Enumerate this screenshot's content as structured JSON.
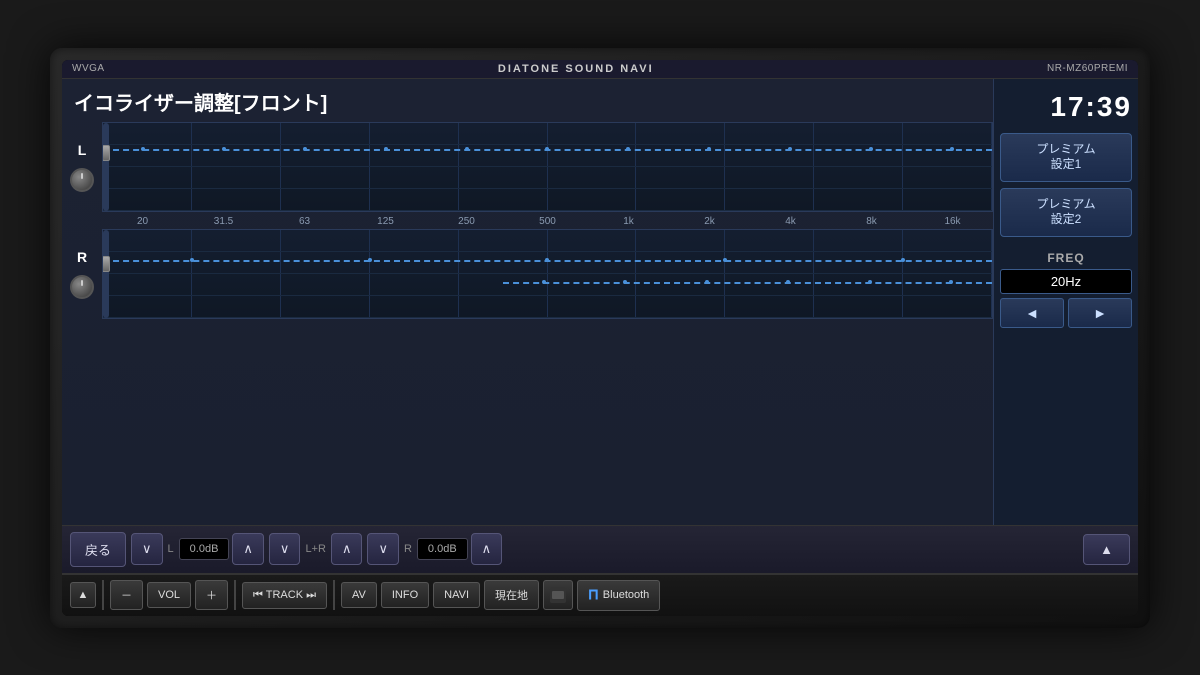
{
  "device": {
    "brand": "DIATONE SOUND NAVI",
    "model": "NR-MZ60PREMI",
    "screen_type": "WVGA"
  },
  "header": {
    "screen_type": "WVGA",
    "brand": "DIATONE SOUND NAVI",
    "model": "NR-MZ60PREMI",
    "time": "17:39"
  },
  "eq_screen": {
    "title": "イコライザー調整[フロント]",
    "channels": [
      "L",
      "R"
    ],
    "freq_labels": [
      "20",
      "31.5",
      "63",
      "125",
      "250",
      "500",
      "1k",
      "2k",
      "4k",
      "8k",
      "16k"
    ],
    "presets": [
      {
        "label": "プレミアム\n設定1"
      },
      {
        "label": "プレミアム\n設定2"
      }
    ],
    "freq_section": {
      "label": "FREQ",
      "value": "20Hz",
      "prev_label": "◄",
      "next_label": "►"
    }
  },
  "control_bar": {
    "back_label": "戻る",
    "down_label": "∨",
    "l_label": "L",
    "l_value": "0.0dB",
    "up_label": "∧",
    "lr_down_label": "∨",
    "lr_label": "L+R",
    "lr_up_label": "∧",
    "r_down_label": "∨",
    "r_label": "R",
    "r_value": "0.0dB",
    "r_up_label": "∧",
    "triangle_up_label": "▲"
  },
  "bottom_bar": {
    "eject_label": "▲",
    "vol_minus": "－",
    "vol_label": "VOL",
    "vol_plus": "＋",
    "track_prev": "⏮",
    "track_label": "TRACK",
    "track_next": "⏭",
    "av_label": "AV",
    "info_label": "INFO",
    "navi_label": "NAVI",
    "location_label": "現在地",
    "bluetooth_label": "Bluetooth"
  }
}
